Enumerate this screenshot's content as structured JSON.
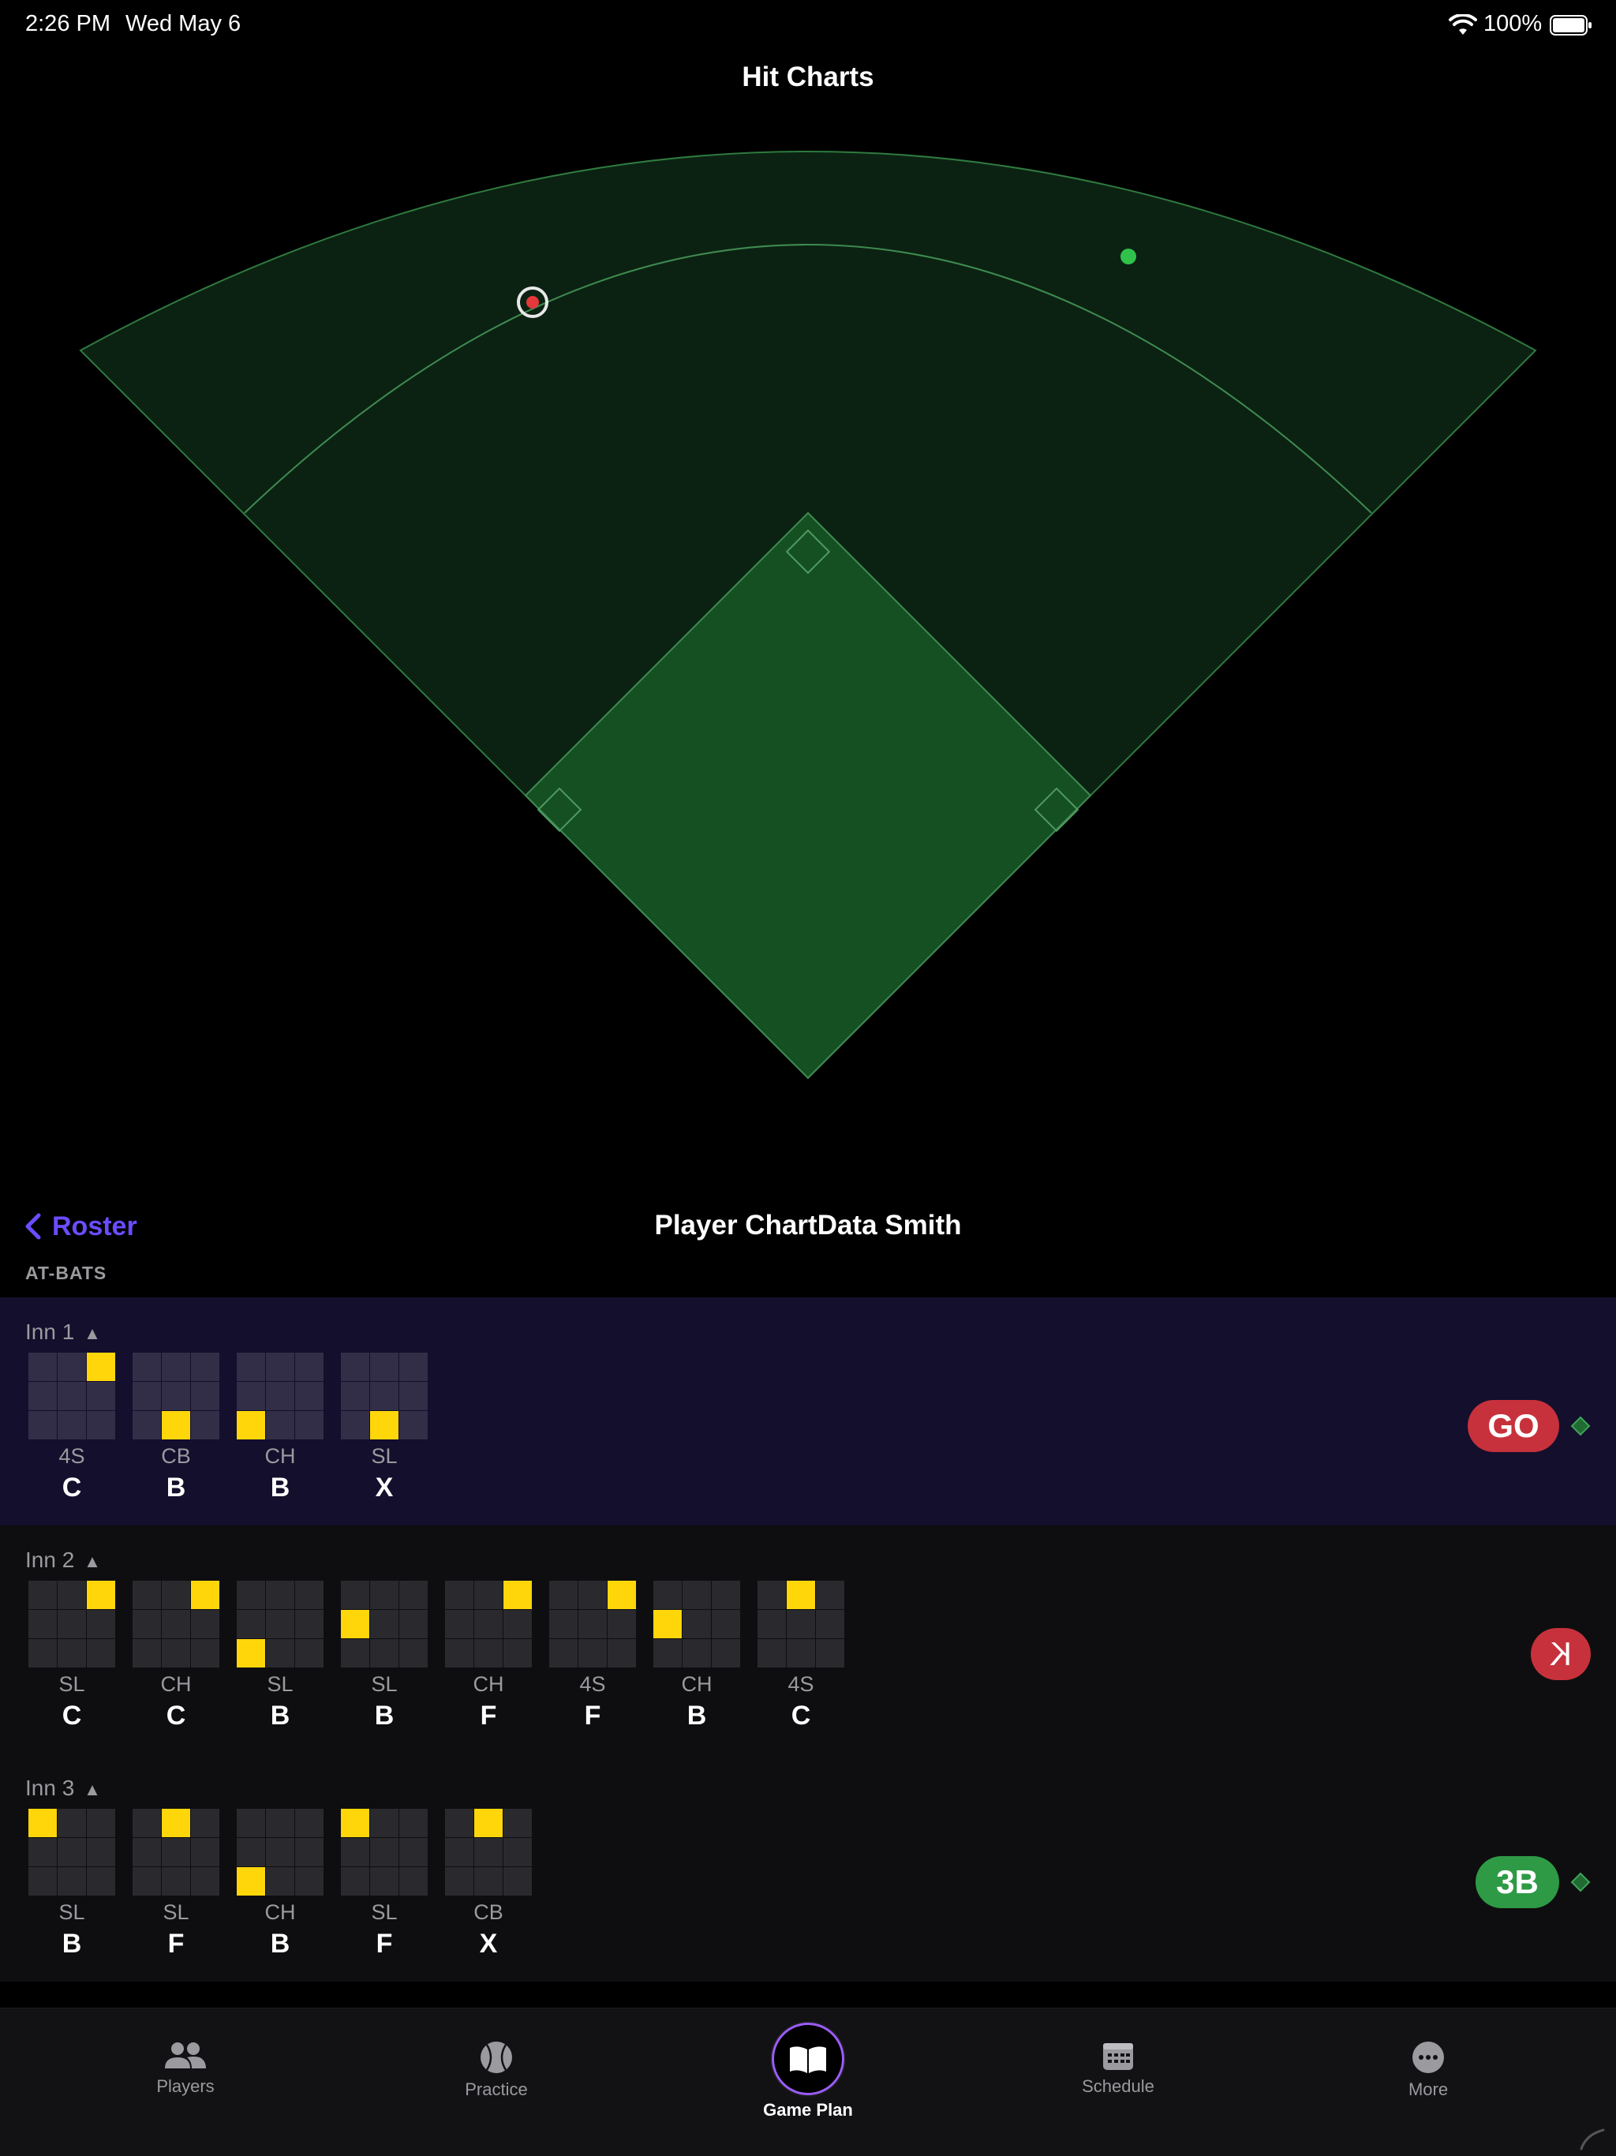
{
  "status": {
    "time": "2:26 PM",
    "date": "Wed May 6",
    "battery": "100%"
  },
  "hit_charts": {
    "title": "Hit Charts",
    "hits": [
      {
        "name": "hit-red-selected",
        "color": "#e5383b"
      },
      {
        "name": "hit-green",
        "color": "#30c24a"
      }
    ],
    "colors": {
      "outfield": "#0b2212",
      "infield": "#155023",
      "line": "#2f7a3f"
    }
  },
  "nav": {
    "back_label": "Roster",
    "title": "Player ChartData Smith"
  },
  "section": {
    "label": "AT-BATS"
  },
  "innings": [
    {
      "label": "Inn 1",
      "indicator": "▲",
      "current": true,
      "result": "GO",
      "result_color": "#c7313b",
      "marker": true,
      "pitches": [
        {
          "type": "4S",
          "result": "C",
          "zone": 2
        },
        {
          "type": "CB",
          "result": "B",
          "zone": 7
        },
        {
          "type": "CH",
          "result": "B",
          "zone": 6
        },
        {
          "type": "SL",
          "result": "X",
          "zone": 7
        }
      ]
    },
    {
      "label": "Inn 2",
      "indicator": "▲",
      "current": false,
      "result": "K",
      "result_color": "#c7313b",
      "marker": false,
      "pitches": [
        {
          "type": "SL",
          "result": "C",
          "zone": 2
        },
        {
          "type": "CH",
          "result": "C",
          "zone": 2
        },
        {
          "type": "SL",
          "result": "B",
          "zone": 6
        },
        {
          "type": "SL",
          "result": "B",
          "zone": 3
        },
        {
          "type": "CH",
          "result": "F",
          "zone": 2
        },
        {
          "type": "4S",
          "result": "F",
          "zone": 2
        },
        {
          "type": "CH",
          "result": "B",
          "zone": 3
        },
        {
          "type": "4S",
          "result": "C",
          "zone": 1
        }
      ]
    },
    {
      "label": "Inn 3",
      "indicator": "▲",
      "current": false,
      "result": "3B",
      "result_color": "#2e9a45",
      "marker": true,
      "pitches": [
        {
          "type": "SL",
          "result": "B",
          "zone": 0
        },
        {
          "type": "SL",
          "result": "F",
          "zone": 1
        },
        {
          "type": "CH",
          "result": "B",
          "zone": 6
        },
        {
          "type": "SL",
          "result": "F",
          "zone": 0
        },
        {
          "type": "CB",
          "result": "X",
          "zone": 1
        }
      ]
    }
  ],
  "tabbar": {
    "players": "Players",
    "practice": "Practice",
    "game_plan": "Game Plan",
    "schedule": "Schedule",
    "more": "More"
  },
  "colors": {
    "accent": "#6b4cff",
    "strike_zone_highlight": "#ffd60a"
  }
}
